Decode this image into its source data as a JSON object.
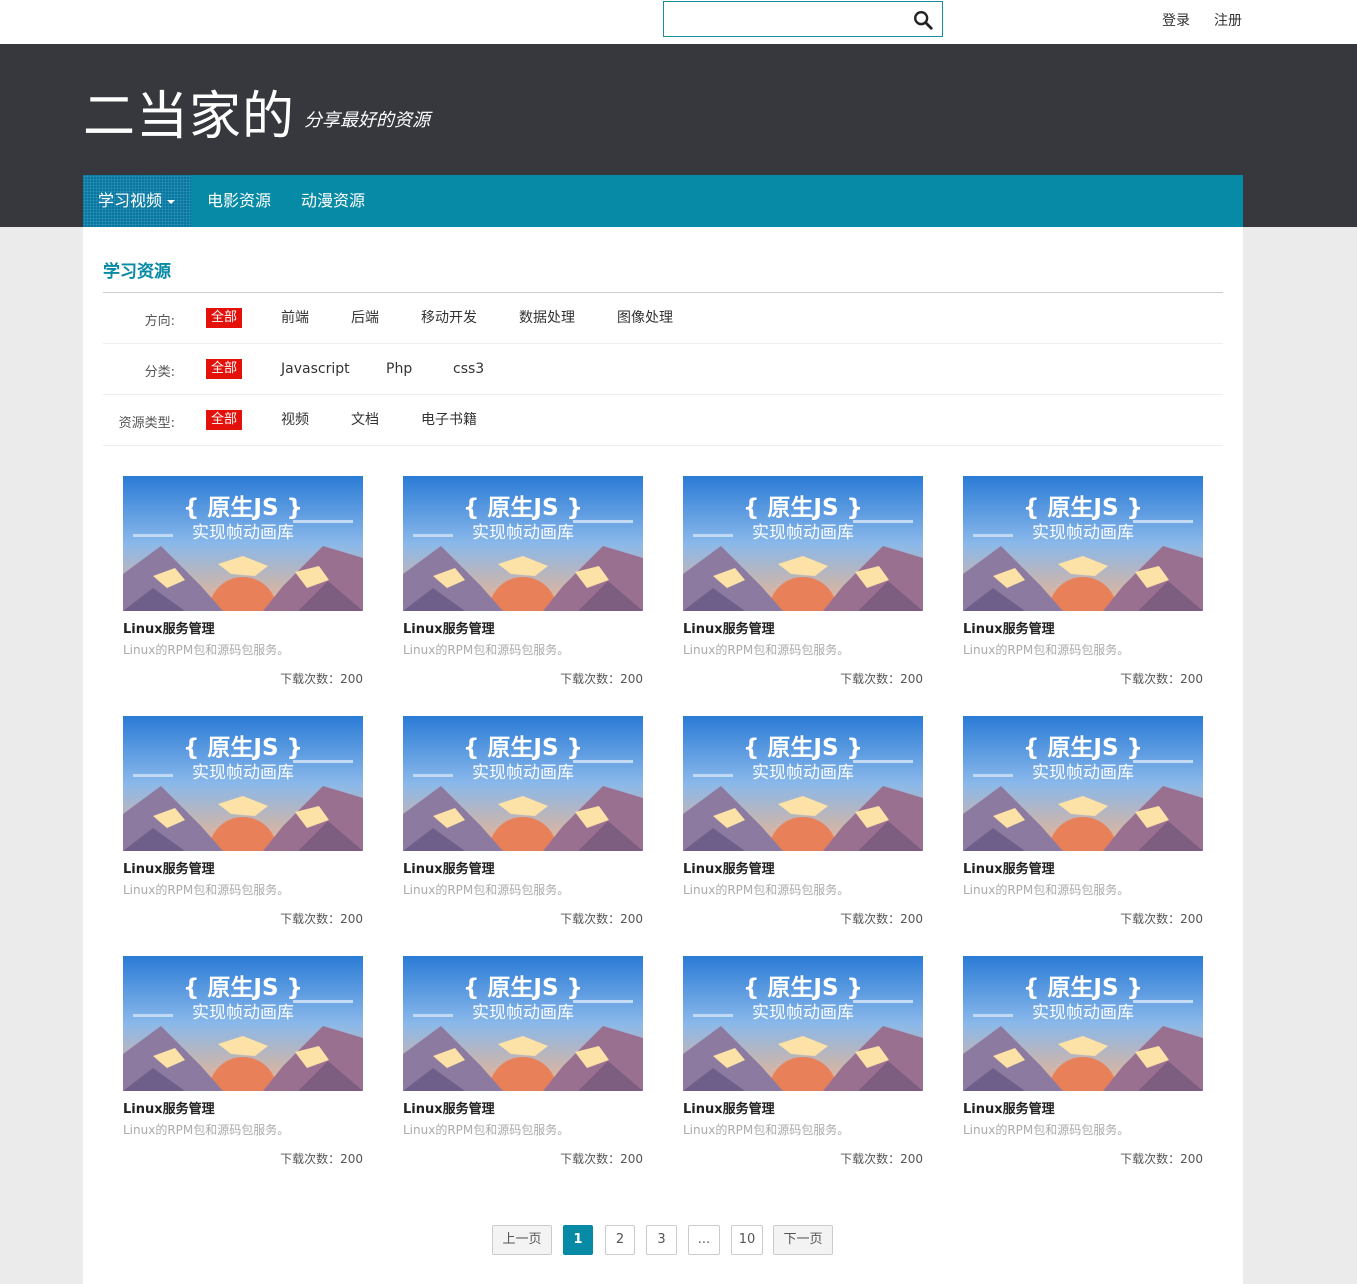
{
  "topbar": {
    "search": {
      "placeholder": "",
      "value": ""
    },
    "login": "登录",
    "register": "注册"
  },
  "header": {
    "site_title": "二当家的",
    "slogan": "分享最好的资源"
  },
  "nav": {
    "items": [
      {
        "label": "学习视频",
        "active": true,
        "has_dropdown": true
      },
      {
        "label": "电影资源",
        "active": false
      },
      {
        "label": "动漫资源",
        "active": false
      }
    ]
  },
  "section": {
    "title": "学习资源"
  },
  "filters": [
    {
      "label": "方向:",
      "options": [
        "全部",
        "前端",
        "后端",
        "移动开发",
        "数据处理",
        "图像处理"
      ],
      "selected": "全部"
    },
    {
      "label": "分类:",
      "options": [
        "全部",
        "Javascript",
        "Php",
        "css3"
      ],
      "selected": "全部"
    },
    {
      "label": "资源类型:",
      "options": [
        "全部",
        "视频",
        "文档",
        "电子书籍"
      ],
      "selected": "全部"
    }
  ],
  "resources": [
    {
      "thumb_line1": "{ 原生JS }",
      "thumb_line2": "实现帧动画库",
      "title": "Linux服务管理",
      "desc": "Linux的RPM包和源码包服务。",
      "downloads": "下载次数：200"
    },
    {
      "thumb_line1": "{ 原生JS }",
      "thumb_line2": "实现帧动画库",
      "title": "Linux服务管理",
      "desc": "Linux的RPM包和源码包服务。",
      "downloads": "下载次数：200"
    },
    {
      "thumb_line1": "{ 原生JS }",
      "thumb_line2": "实现帧动画库",
      "title": "Linux服务管理",
      "desc": "Linux的RPM包和源码包服务。",
      "downloads": "下载次数：200"
    },
    {
      "thumb_line1": "{ 原生JS }",
      "thumb_line2": "实现帧动画库",
      "title": "Linux服务管理",
      "desc": "Linux的RPM包和源码包服务。",
      "downloads": "下载次数：200"
    },
    {
      "thumb_line1": "{ 原生JS }",
      "thumb_line2": "实现帧动画库",
      "title": "Linux服务管理",
      "desc": "Linux的RPM包和源码包服务。",
      "downloads": "下载次数：200"
    },
    {
      "thumb_line1": "{ 原生JS }",
      "thumb_line2": "实现帧动画库",
      "title": "Linux服务管理",
      "desc": "Linux的RPM包和源码包服务。",
      "downloads": "下载次数：200"
    },
    {
      "thumb_line1": "{ 原生JS }",
      "thumb_line2": "实现帧动画库",
      "title": "Linux服务管理",
      "desc": "Linux的RPM包和源码包服务。",
      "downloads": "下载次数：200"
    },
    {
      "thumb_line1": "{ 原生JS }",
      "thumb_line2": "实现帧动画库",
      "title": "Linux服务管理",
      "desc": "Linux的RPM包和源码包服务。",
      "downloads": "下载次数：200"
    },
    {
      "thumb_line1": "{ 原生JS }",
      "thumb_line2": "实现帧动画库",
      "title": "Linux服务管理",
      "desc": "Linux的RPM包和源码包服务。",
      "downloads": "下载次数：200"
    },
    {
      "thumb_line1": "{ 原生JS }",
      "thumb_line2": "实现帧动画库",
      "title": "Linux服务管理",
      "desc": "Linux的RPM包和源码包服务。",
      "downloads": "下载次数：200"
    },
    {
      "thumb_line1": "{ 原生JS }",
      "thumb_line2": "实现帧动画库",
      "title": "Linux服务管理",
      "desc": "Linux的RPM包和源码包服务。",
      "downloads": "下载次数：200"
    },
    {
      "thumb_line1": "{ 原生JS }",
      "thumb_line2": "实现帧动画库",
      "title": "Linux服务管理",
      "desc": "Linux的RPM包和源码包服务。",
      "downloads": "下载次数：200"
    }
  ],
  "pagination": {
    "prev": "上一页",
    "pages": [
      "1",
      "2",
      "3",
      "...",
      "10"
    ],
    "current": "1",
    "next": "下一页"
  },
  "colors": {
    "accent": "#068aa5",
    "header_bg": "#36383d",
    "filter_active": "#e4100a"
  }
}
